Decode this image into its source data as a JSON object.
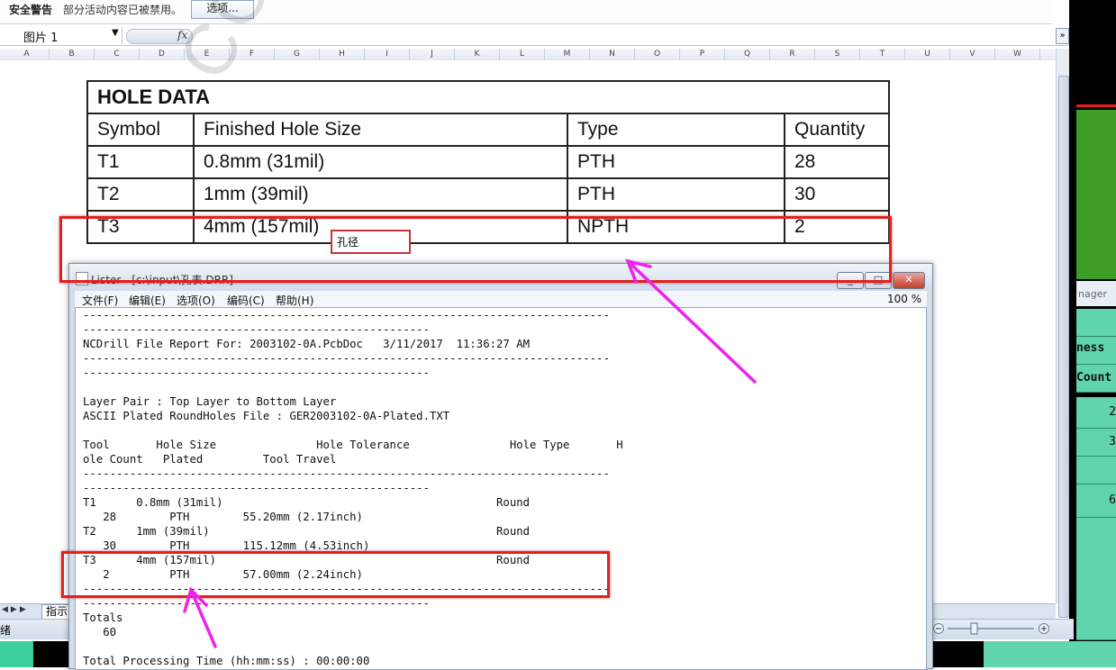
{
  "security_bar": {
    "title": "安全警告",
    "message": "部分活动内容已被禁用。",
    "options_button": "选项..."
  },
  "formula_bar": {
    "name_box": "图片 1",
    "fx_label": "fx"
  },
  "columns": [
    "A",
    "B",
    "C",
    "D",
    "E",
    "F",
    "G",
    "H",
    "I",
    "J",
    "K",
    "L",
    "M",
    "N",
    "O",
    "P",
    "Q",
    "R",
    "S",
    "T",
    "U",
    "V",
    "W"
  ],
  "hole_table": {
    "title": "HOLE DATA",
    "headers": [
      "Symbol",
      "Finished Hole Size",
      "Type",
      "Quantity"
    ],
    "rows": [
      [
        "T1",
        "0.8mm (31mil)",
        "PTH",
        "28"
      ],
      [
        "T2",
        "1mm (39mil)",
        "PTH",
        "30"
      ],
      [
        "T3",
        "4mm (157mil)",
        "NPTH",
        "2"
      ]
    ],
    "annotation": "孔径",
    "watermark": "CONTRO"
  },
  "sheet_tab": "指示",
  "status_left": "绪",
  "lister": {
    "title": "Lister - [c:\\input\\孔表.DRR]",
    "menu": [
      "文件(F)",
      "编辑(E)",
      "选项(O)",
      "编码(C)",
      "帮助(H)"
    ],
    "zoom": "100 %",
    "lines": [
      "-------------------------------------------------------------------------------",
      "----------------------------------------------------",
      "NCDrill File Report For: 2003102-0A.PcbDoc   3/11/2017  11:36:27 AM",
      "-------------------------------------------------------------------------------",
      "----------------------------------------------------",
      "",
      "Layer Pair : Top Layer to Bottom Layer",
      "ASCII Plated RoundHoles File : GER2003102-0A-Plated.TXT",
      "",
      "Tool       Hole Size               Hole Tolerance               Hole Type       H",
      "ole Count   Plated         Tool Travel",
      "-------------------------------------------------------------------------------",
      "----------------------------------------------------",
      "T1      0.8mm (31mil)                                         Round",
      "   28        PTH        55.20mm (2.17inch)",
      "T2      1mm (39mil)                                           Round",
      "   30        PTH        115.12mm (4.53inch)",
      "T3      4mm (157mil)                                          Round",
      "   2         PTH        57.00mm (2.24inch)",
      "-------------------------------------------------------------------------------",
      "----------------------------------------------------",
      "Totals",
      "   60",
      "",
      "Total Processing Time (hh:mm:ss) : 00:00:00"
    ]
  },
  "right_app": {
    "labels": [
      "nager",
      "ness",
      "Count",
      "2",
      "3",
      "6"
    ]
  },
  "colors": {
    "highlight_red": "#e2211c",
    "arrow_magenta": "#ee22ee",
    "right_green": "#5fd4ad"
  }
}
